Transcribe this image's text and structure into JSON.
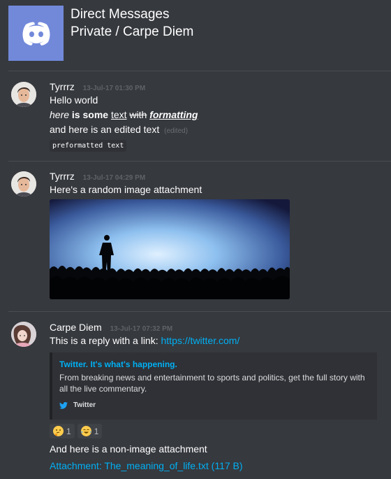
{
  "header": {
    "line1": "Direct Messages",
    "line2": "Private / Carpe Diem",
    "icon": "discord-logo-icon",
    "accent": "#7289da"
  },
  "groups": [
    {
      "author": "Tyrrrz",
      "timestamp": "13-Jul-17 01:30 PM",
      "avatar": "avatar-tyrrrz",
      "lines": {
        "hello": "Hello world",
        "fmt_italic": "here",
        "fmt_bold": "is some",
        "fmt_underline": "text",
        "fmt_strike": "with",
        "fmt_all": "formatting",
        "edited_text": "and here is an edited text",
        "edited_tag": "(edited)",
        "preformatted": "preformatted text"
      }
    },
    {
      "author": "Tyrrrz",
      "timestamp": "13-Jul-17 04:29 PM",
      "avatar": "avatar-tyrrrz",
      "text": "Here's a random image attachment",
      "image": "concert-crowd-image"
    },
    {
      "author": "Carpe Diem",
      "timestamp": "13-Jul-17 07:32 PM",
      "avatar": "avatar-carpe-diem",
      "text_prefix": "This is a reply with a link:",
      "link": "https://twitter.com/",
      "embed": {
        "title": "Twitter. It's what's happening.",
        "description": "From breaking news and entertainment to sports and politics, get the full story with all the live commentary.",
        "footer": "Twitter",
        "footer_icon": "twitter-bird-icon"
      },
      "reactions": [
        {
          "emoji": "thinking-face-icon",
          "count": "1"
        },
        {
          "emoji": "joy-face-icon",
          "count": "1"
        }
      ],
      "text2": "And here is a non-image attachment",
      "attachment": "Attachment: The_meaning_of_life.txt (117 B)"
    }
  ]
}
